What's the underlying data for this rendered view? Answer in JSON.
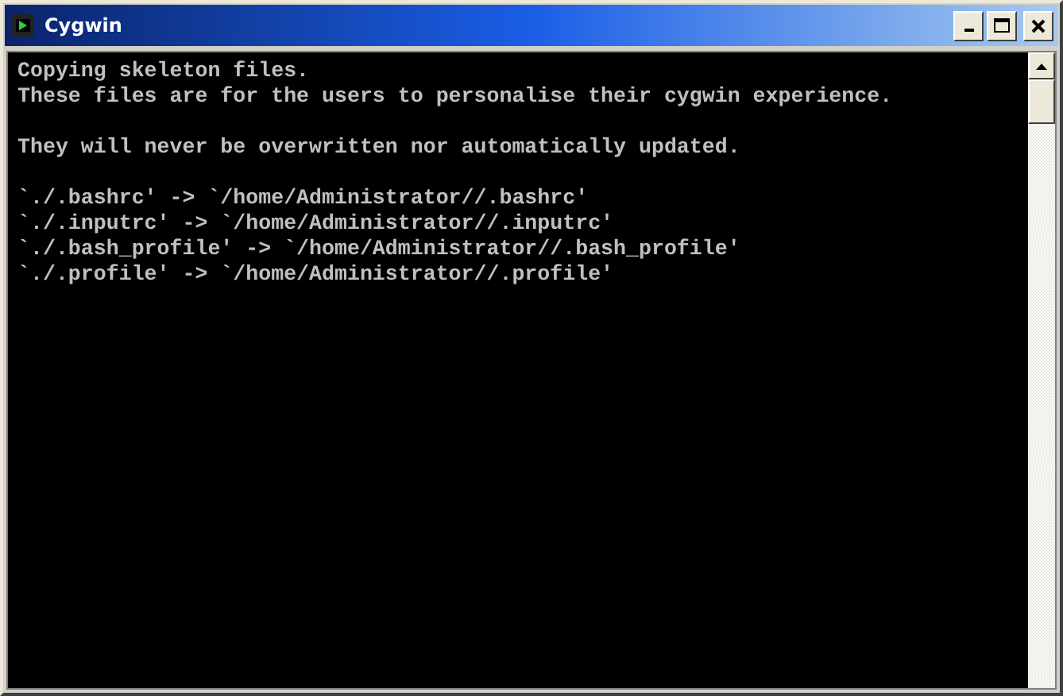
{
  "window": {
    "title": "Cygwin"
  },
  "console": {
    "paragraphs": [
      [
        "Copying skeleton files.",
        "These files are for the users to personalise their cygwin experience."
      ],
      [
        "They will never be overwritten nor automatically updated."
      ],
      [
        "`./.bashrc' -> `/home/Administrator//.bashrc'",
        "`./.inputrc' -> `/home/Administrator//.inputrc'",
        "`./.bash_profile' -> `/home/Administrator//.bash_profile'",
        "`./.profile' -> `/home/Administrator//.profile'"
      ]
    ]
  }
}
